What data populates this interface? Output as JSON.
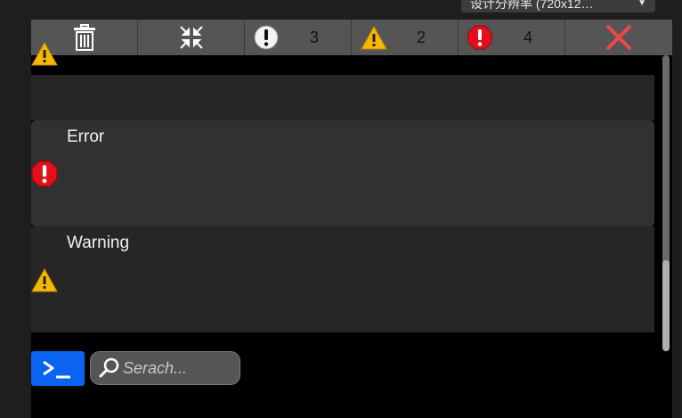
{
  "header": {
    "resolution_label": "设计分辨率 (720x12…",
    "dropdown_icon": "chevron-down-icon"
  },
  "toolbar": {
    "clear_icon": "trash-icon",
    "collapse_icon": "collapse-icon",
    "info_count": "3",
    "warning_count": "2",
    "error_count": "4",
    "close_icon": "close-icon"
  },
  "logs": [
    {
      "level": "warning",
      "message": ""
    },
    {
      "level": "none",
      "message": ""
    },
    {
      "level": "error",
      "message": "Error"
    },
    {
      "level": "warning",
      "message": "Warning"
    }
  ],
  "command": {
    "icon": "terminal-prompt-icon"
  },
  "search": {
    "placeholder": "Serach..."
  },
  "colors": {
    "toolbar": "#555555",
    "row_light": "#313131",
    "row_dark": "#262626",
    "error_red": "#e0111b",
    "warning_yellow": "#f5b800",
    "close_red": "#f04848",
    "command_blue": "#0a64f0"
  }
}
